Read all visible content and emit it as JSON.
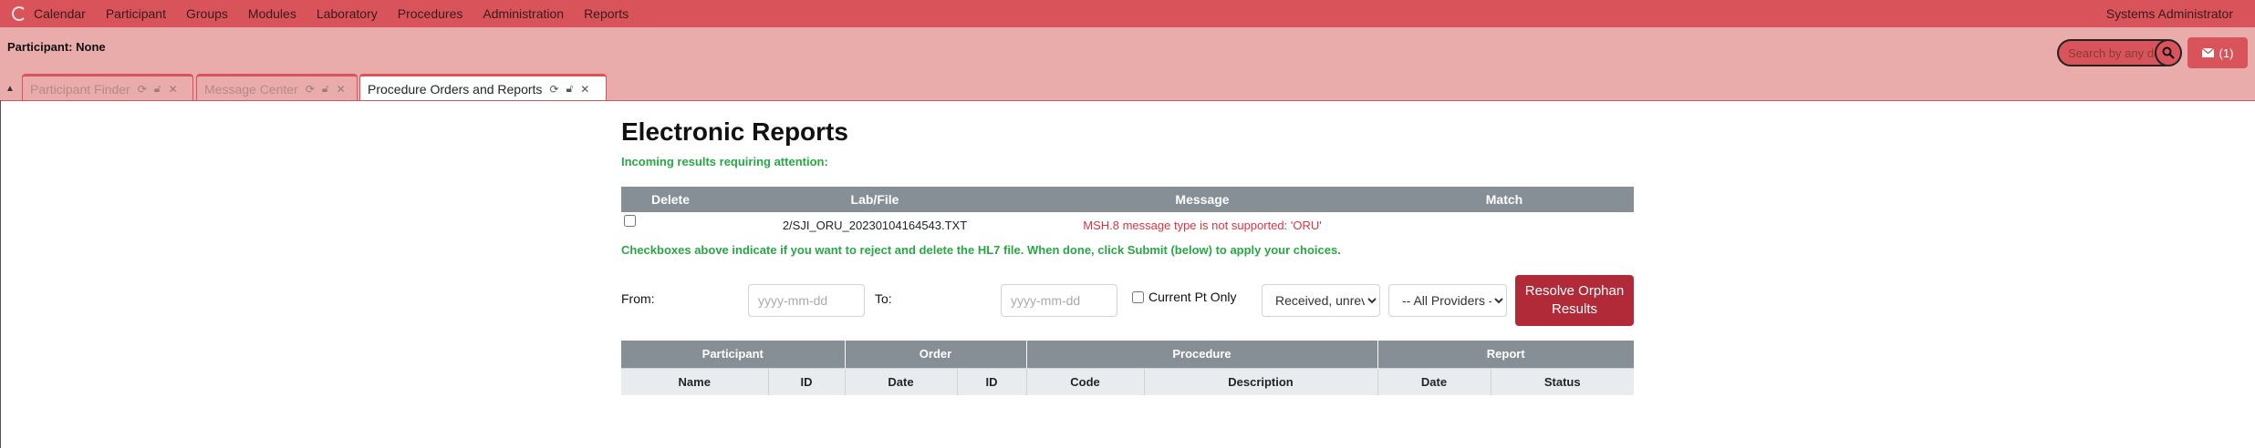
{
  "menubar": {
    "items": [
      "Calendar",
      "Participant",
      "Groups",
      "Modules",
      "Laboratory",
      "Procedures",
      "Administration",
      "Reports"
    ],
    "user": "Systems Administrator"
  },
  "header": {
    "participant": "Participant: None",
    "search_placeholder": "Search by any de",
    "messages_label": "(1)"
  },
  "tabs": [
    {
      "label": "Participant Finder",
      "active": false
    },
    {
      "label": "Message Center",
      "active": false
    },
    {
      "label": "Procedure Orders and Reports",
      "active": true
    }
  ],
  "main": {
    "title": "Electronic Reports",
    "incoming_text": "Incoming results requiring attention:",
    "incoming_table": {
      "headers": [
        "Delete",
        "Lab/File",
        "Message",
        "Match"
      ],
      "rows": [
        {
          "file": "2/SJI_ORU_20230104164543.TXT",
          "message": "MSH.8 message type is not supported: 'ORU'"
        }
      ]
    },
    "note": "Checkboxes above indicate if you want to reject and delete the HL7 file. When done, click Submit (below) to apply your choices.",
    "filters": {
      "from_label": "From:",
      "to_label": "To:",
      "date_placeholder": "yyyy-mm-dd",
      "current_pt_label": "Current Pt Only",
      "status_select": "Received, unreviewed",
      "provider_select": "-- All Providers --",
      "resolve_button": "Resolve Orphan Results"
    },
    "results_table": {
      "groups": [
        "Participant",
        "Order",
        "Procedure",
        "Report"
      ],
      "columns": [
        "Name",
        "ID",
        "Date",
        "ID",
        "Code",
        "Description",
        "Date",
        "Status"
      ]
    }
  }
}
